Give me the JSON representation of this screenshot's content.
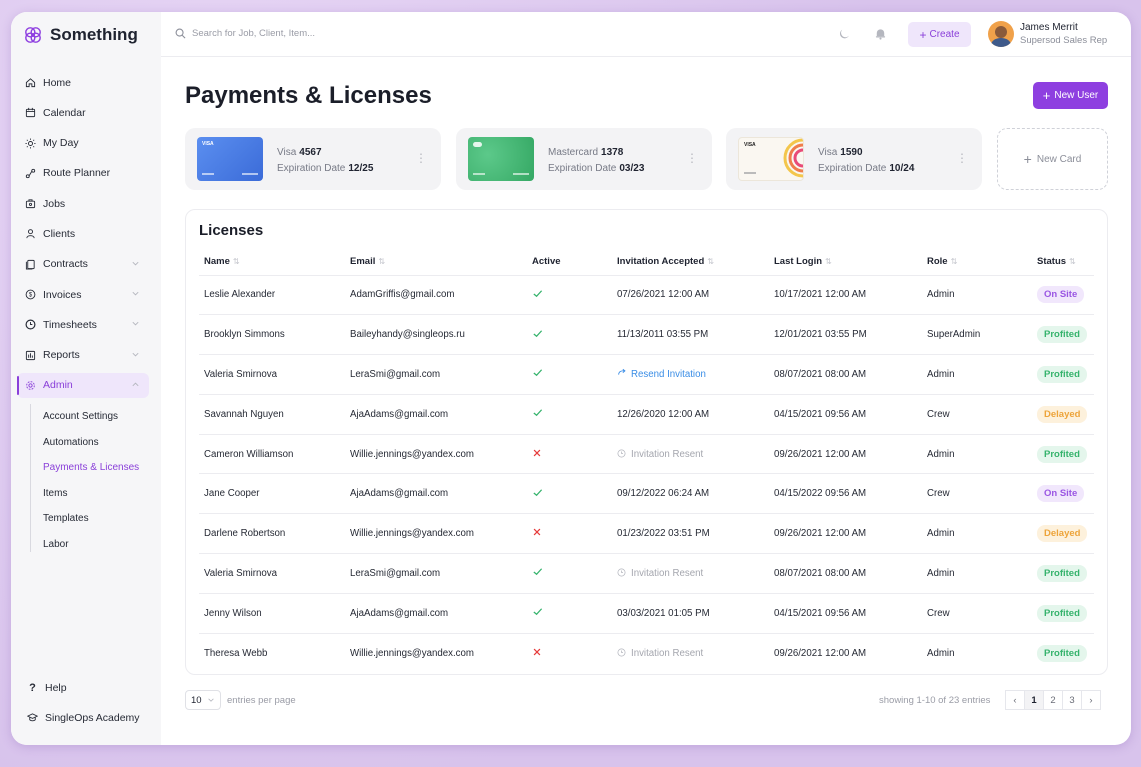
{
  "brand": {
    "name": "Something"
  },
  "search": {
    "placeholder": "Search for Job, Client, Item..."
  },
  "header": {
    "create_label": "Create",
    "user_name": "James Merrit",
    "user_role": "Supersod Sales Rep"
  },
  "sidebar": {
    "items": [
      {
        "label": "Home",
        "icon": "home-icon"
      },
      {
        "label": "Calendar",
        "icon": "calendar-icon"
      },
      {
        "label": "My Day",
        "icon": "sun-icon"
      },
      {
        "label": "Route Planner",
        "icon": "route-icon"
      },
      {
        "label": "Jobs",
        "icon": "briefcase-icon"
      },
      {
        "label": "Clients",
        "icon": "user-icon"
      },
      {
        "label": "Contracts",
        "icon": "contract-icon"
      },
      {
        "label": "Invoices",
        "icon": "dollar-icon"
      },
      {
        "label": "Timesheets",
        "icon": "clock-icon"
      },
      {
        "label": "Reports",
        "icon": "chart-icon"
      },
      {
        "label": "Admin",
        "icon": "gear-icon"
      }
    ],
    "sub_items": [
      "Account Settings",
      "Automations",
      "Payments & Licenses",
      "Items",
      "Templates",
      "Labor"
    ],
    "bottom": [
      {
        "label": "Help",
        "icon": "question-icon"
      },
      {
        "label": "SingleOps Academy",
        "icon": "graduation-cap-icon"
      }
    ]
  },
  "page": {
    "title": "Payments & Licenses",
    "new_user_label": "New User"
  },
  "cards": [
    {
      "brand": "Visa",
      "last4": "4567",
      "exp_label": "Expiration Date",
      "exp": "12/25",
      "color": "#4a7fe0"
    },
    {
      "brand": "Mastercard",
      "last4": "1378",
      "exp_label": "Expiration Date",
      "exp": "03/23",
      "color": "#3fb574"
    },
    {
      "brand": "Visa",
      "last4": "1590",
      "exp_label": "Expiration Date",
      "exp": "10/24",
      "color": "#f6f2ea"
    }
  ],
  "new_card_label": "New Card",
  "licenses": {
    "title": "Licenses",
    "columns": [
      "Name",
      "Email",
      "Active",
      "Invitation Accepted",
      "Last Login",
      "Role",
      "Status"
    ],
    "rows": [
      {
        "name": "Leslie Alexander",
        "email": "AdamGriffis@gmail.com",
        "active": true,
        "invitation": "07/26/2021 12:00 AM",
        "inv_type": "date",
        "last_login": "10/17/2021 12:00 AM",
        "role": "Admin",
        "status": "On Site"
      },
      {
        "name": "Brooklyn Simmons",
        "email": "Baileyhandy@singleops.ru",
        "active": true,
        "invitation": "11/13/2011 03:55 PM",
        "inv_type": "date",
        "last_login": "12/01/2021 03:55 PM",
        "role": "SuperAdmin",
        "status": "Profited"
      },
      {
        "name": "Valeria Smirnova",
        "email": "LeraSmi@gmail.com",
        "active": true,
        "invitation": "Resend Invitation",
        "inv_type": "resend",
        "last_login": "08/07/2021 08:00 AM",
        "role": "Admin",
        "status": "Profited"
      },
      {
        "name": "Savannah Nguyen",
        "email": "AjaAdams@gmail.com",
        "active": true,
        "invitation": "12/26/2020 12:00 AM",
        "inv_type": "date",
        "last_login": "04/15/2021 09:56 AM",
        "role": "Crew",
        "status": "Delayed"
      },
      {
        "name": "Cameron Williamson",
        "email": "Willie.jennings@yandex.com",
        "active": false,
        "invitation": "Invitation Resent",
        "inv_type": "resent",
        "last_login": "09/26/2021 12:00 AM",
        "role": "Admin",
        "status": "Profited"
      },
      {
        "name": "Jane Cooper",
        "email": "AjaAdams@gmail.com",
        "active": true,
        "invitation": "09/12/2022 06:24 AM",
        "inv_type": "date",
        "last_login": "04/15/2022 09:56 AM",
        "role": "Crew",
        "status": "On Site"
      },
      {
        "name": "Darlene Robertson",
        "email": "Willie.jennings@yandex.com",
        "active": false,
        "invitation": "01/23/2022 03:51 PM",
        "inv_type": "date",
        "last_login": "09/26/2021 12:00 AM",
        "role": "Admin",
        "status": "Delayed"
      },
      {
        "name": "Valeria Smirnova",
        "email": "LeraSmi@gmail.com",
        "active": true,
        "invitation": "Invitation Resent",
        "inv_type": "resent",
        "last_login": "08/07/2021 08:00 AM",
        "role": "Admin",
        "status": "Profited"
      },
      {
        "name": "Jenny Wilson",
        "email": "AjaAdams@gmail.com",
        "active": true,
        "invitation": "03/03/2021 01:05 PM",
        "inv_type": "date",
        "last_login": "04/15/2021 09:56 AM",
        "role": "Crew",
        "status": "Profited"
      },
      {
        "name": "Theresa Webb",
        "email": "Willie.jennings@yandex.com",
        "active": false,
        "invitation": "Invitation Resent",
        "inv_type": "resent",
        "last_login": "09/26/2021 12:00 AM",
        "role": "Admin",
        "status": "Profited"
      }
    ]
  },
  "footer": {
    "per_page_value": "10",
    "per_page_label": "entries per page",
    "showing": "showing 1-10 of 23 entries",
    "pages": [
      "1",
      "2",
      "3"
    ],
    "current_page": "1"
  },
  "colors": {
    "accent": "#8e3fe0",
    "check": "#35b36c",
    "cross": "#e63b3b",
    "link": "#3a8de6"
  }
}
